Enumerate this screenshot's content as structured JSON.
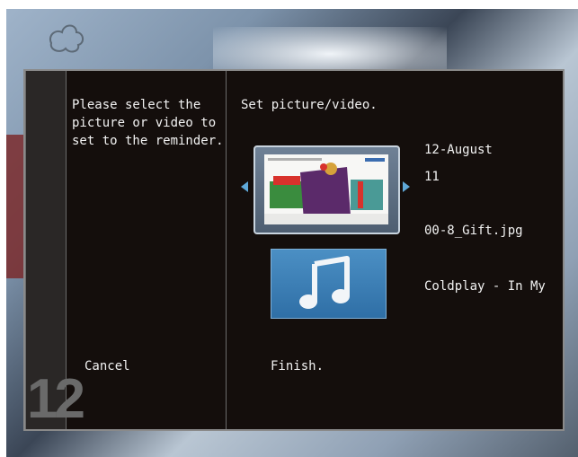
{
  "calendar": {
    "day_number": "12"
  },
  "reminder": {
    "instruction": "Please select the\npicture or video to\nset to the reminder.",
    "step_title": "Set picture/video.",
    "date_line1": "12-August",
    "date_line2": "11",
    "selected_file": "00-8_Gift.jpg",
    "selected_song": "Coldplay - In My"
  },
  "actions": {
    "cancel_label": "Cancel",
    "finish_label": "Finish."
  },
  "icons": {
    "prev": "chevron-left-icon",
    "next": "chevron-right-icon",
    "music": "music-note-icon",
    "background_leaf": "leaf-icon"
  },
  "colors": {
    "accent": "#5fa8d8",
    "panel_bg": "#140e0c",
    "text": "#f2f2f2",
    "music_tile": "#3a7fb7"
  }
}
